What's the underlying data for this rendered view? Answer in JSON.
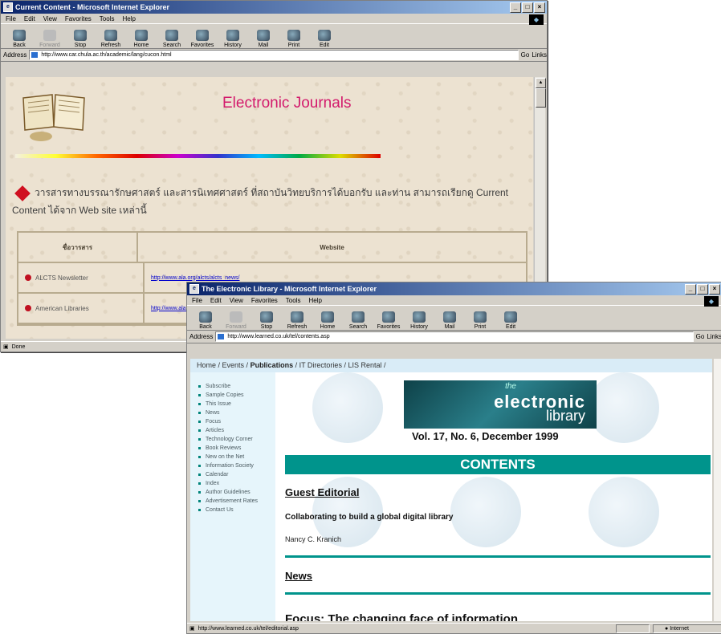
{
  "window1": {
    "title": "Current Content - Microsoft Internet Explorer",
    "menu": [
      "File",
      "Edit",
      "View",
      "Favorites",
      "Tools",
      "Help"
    ],
    "toolbar": [
      "Back",
      "Forward",
      "Stop",
      "Refresh",
      "Home",
      "Search",
      "Favorites",
      "History",
      "Mail",
      "Print",
      "Edit"
    ],
    "address_label": "Address",
    "url": "http://www.car.chula.ac.th/academic/lang/cucon.html",
    "go_label": "Go",
    "links_label": "Links",
    "page": {
      "heading": "Electronic Journals",
      "intro": "วารสารทางบรรณารักษศาสตร์ และสารนิเทศศาสตร์ ที่สถาบันวิทยบริการได้บอกรับ และท่าน สามารถเรียกดู Current Content ได้จาก Web site เหล่านี้",
      "table_headers": [
        "ชื่อวารสาร",
        "Website"
      ],
      "rows": [
        {
          "name": "ALCTS Newsletter",
          "link": "http://www.ala.org/alcts/alcts_news/"
        },
        {
          "name": "American Libraries",
          "link": "http://www.ala.org/alonline/"
        }
      ]
    },
    "status": "Done"
  },
  "window2": {
    "title": "The Electronic Library - Microsoft Internet Explorer",
    "menu": [
      "File",
      "Edit",
      "View",
      "Favorites",
      "Tools",
      "Help"
    ],
    "toolbar": [
      "Back",
      "Forward",
      "Stop",
      "Refresh",
      "Home",
      "Search",
      "Favorites",
      "History",
      "Mail",
      "Print",
      "Edit"
    ],
    "address_label": "Address",
    "url": "http://www.learned.co.uk/tel/contents.asp",
    "go_label": "Go",
    "links_label": "Links",
    "breadcrumb": [
      "Home",
      "Events",
      "Publications",
      "IT Directories",
      "LIS Rental"
    ],
    "sidebar": [
      "Subscribe",
      "Sample Copies",
      "This Issue",
      "News",
      "Focus",
      "Articles",
      "Technology Corner",
      "Book Reviews",
      "New on the Net",
      "Information Society",
      "Calendar",
      "Index",
      "Author Guidelines",
      "Advertisement Rates",
      "Contact Us"
    ],
    "logo": {
      "small": "the",
      "line1": "electronic",
      "line2": "library"
    },
    "volume": "Vol. 17, No. 6, December 1999",
    "contents_label": "CONTENTS",
    "sections": {
      "guest_editorial": "Guest Editorial",
      "editorial_article": "Collaborating to build a global digital library",
      "editorial_author": "Nancy C. Kranich",
      "news": "News",
      "focus": "Focus: The changing face of information"
    },
    "status": "http://www.learned.co.uk/tel/editorial.asp",
    "zone": "Internet"
  }
}
